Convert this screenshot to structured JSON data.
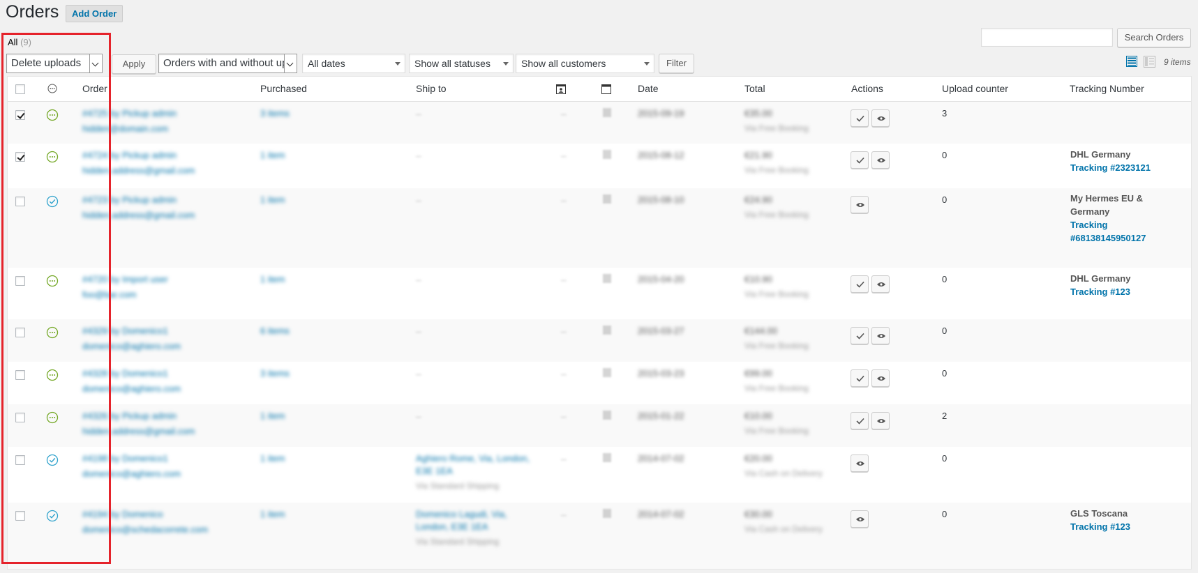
{
  "header": {
    "title": "Orders",
    "add_label": "Add Order"
  },
  "views": {
    "all_label": "All",
    "all_count": "(9)"
  },
  "search": {
    "button_label": "Search Orders",
    "value": ""
  },
  "toolbar": {
    "bulk_action": "Delete uploads",
    "apply_label": "Apply",
    "uploads_filter": "Orders with and without uploads",
    "dates_filter": "All dates",
    "status_filter": "Show all statuses",
    "customer_filter": "Show all customers",
    "filter_label": "Filter",
    "items_count": "9 items"
  },
  "columns": {
    "order": "Order",
    "purchased": "Purchased",
    "ship_to": "Ship to",
    "date": "Date",
    "total": "Total",
    "actions": "Actions",
    "upload_counter": "Upload counter",
    "tracking": "Tracking Number"
  },
  "icons": {
    "processing_color": "#73a724",
    "completed_color": "#2ea2cc",
    "link_color": "#0073aa",
    "highlight_color": "#e5232b"
  },
  "rows": [
    {
      "checked": true,
      "status": "processing",
      "upload_counter": "3",
      "carrier": "",
      "tracking": ""
    },
    {
      "checked": true,
      "status": "processing",
      "upload_counter": "0",
      "carrier": "DHL Germany",
      "tracking": "Tracking #2323121"
    },
    {
      "checked": false,
      "status": "completed",
      "upload_counter": "0",
      "carrier_line1": "My Hermes EU &",
      "carrier_line2": "Germany",
      "tracking_line1": "Tracking",
      "tracking_line2": "#68138145950127"
    },
    {
      "checked": false,
      "status": "processing",
      "upload_counter": "0",
      "carrier": "DHL Germany",
      "tracking": "Tracking #123"
    },
    {
      "checked": false,
      "status": "processing",
      "upload_counter": "0",
      "carrier": "",
      "tracking": ""
    },
    {
      "checked": false,
      "status": "processing",
      "upload_counter": "0",
      "carrier": "",
      "tracking": ""
    },
    {
      "checked": false,
      "status": "processing",
      "upload_counter": "2",
      "carrier": "",
      "tracking": ""
    },
    {
      "checked": false,
      "status": "completed",
      "upload_counter": "0",
      "carrier": "",
      "tracking": ""
    },
    {
      "checked": false,
      "status": "completed",
      "upload_counter": "0",
      "carrier": "GLS Toscana",
      "tracking": "Tracking #123"
    }
  ]
}
